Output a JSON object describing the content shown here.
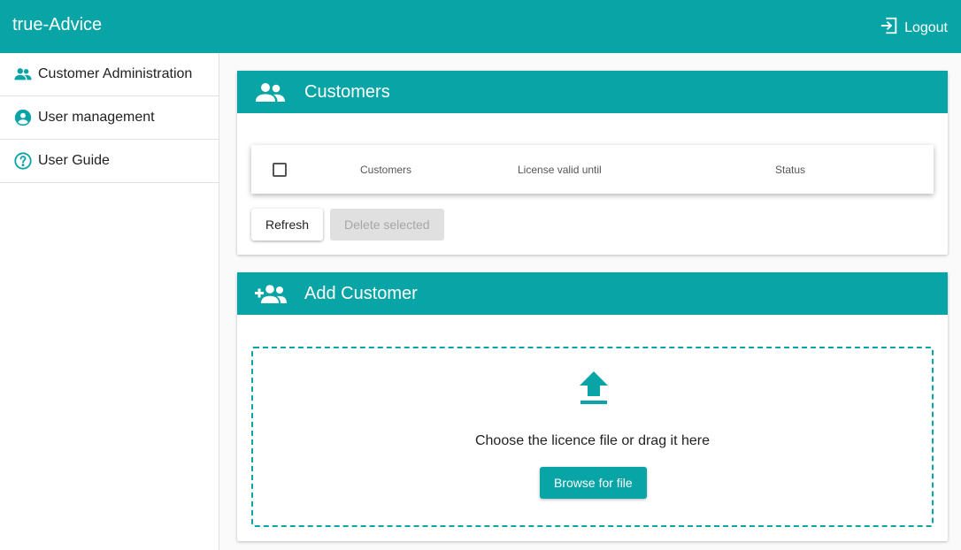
{
  "app": {
    "title": "true-Advice",
    "logout_label": "Logout"
  },
  "sidebar": {
    "items": [
      {
        "label": "Customer Administration",
        "icon": "people-icon"
      },
      {
        "label": "User management",
        "icon": "account-circle-icon"
      },
      {
        "label": "User Guide",
        "icon": "help-circle-icon"
      }
    ]
  },
  "customers_card": {
    "title": "Customers",
    "columns": [
      "Customers",
      "License valid until",
      "Status"
    ],
    "refresh_label": "Refresh",
    "delete_label": "Delete selected"
  },
  "add_card": {
    "title": "Add Customer",
    "drop_text": "Choose the licence file or drag it here",
    "browse_label": "Browse for file"
  },
  "colors": {
    "accent": "#09a4a6",
    "disabled_bg": "#e0e0e0",
    "disabled_text": "#a6a6a6"
  }
}
